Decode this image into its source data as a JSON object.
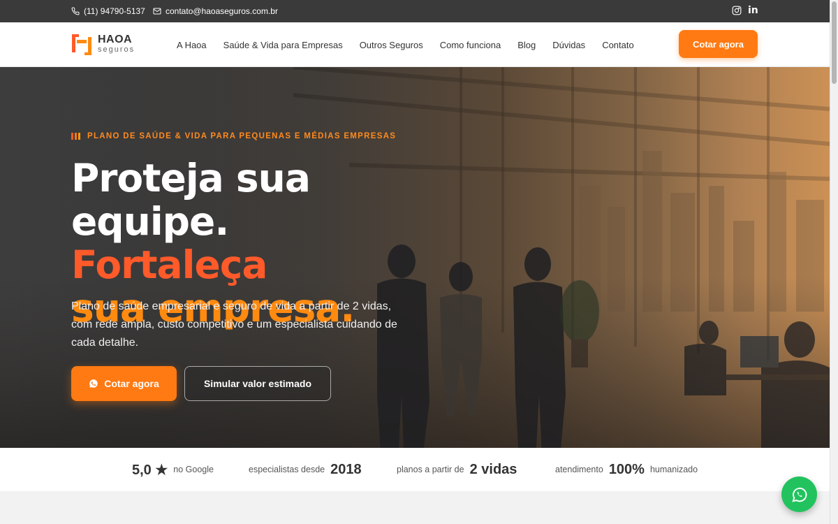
{
  "topbar": {
    "phone": "(11) 94790-5137",
    "email": "contato@haoaseguros.com.br",
    "social": [
      "instagram-icon",
      "linkedin-icon"
    ],
    "linkedin_label": "in"
  },
  "header": {
    "logo_name": "HAOA",
    "logo_sub": "seguros",
    "nav": [
      "A Haoa",
      "Saúde & Vida para Empresas",
      "Outros Seguros",
      "Como funciona",
      "Blog",
      "Dúvidas",
      "Contato"
    ],
    "cta": "Cotar agora"
  },
  "hero": {
    "eyebrow": "PLANO DE SAÚDE & VIDA PARA PEQUENAS E MÉDIAS EMPRESAS",
    "title_part1": "Proteja sua equipe. ",
    "title_part2": "Fortaleça",
    "title_part3": "sua empresa.",
    "description": "Plano de saúde empresarial e seguro de vida a partir de 2 vidas, com rede ampla, custo competitivo e um especialista cuidando de cada detalhe.",
    "primary_button": "Cotar agora",
    "secondary_button": "Simular valor estimado"
  },
  "stats": [
    {
      "value": "5,0 ★",
      "prefix": "",
      "suffix": "no Google"
    },
    {
      "value": "2018",
      "prefix": "especialistas desde",
      "suffix": ""
    },
    {
      "value": "2 vidas",
      "prefix": "planos a partir de",
      "suffix": ""
    },
    {
      "value": "100%",
      "prefix": "atendimento",
      "suffix": "humanizado"
    }
  ],
  "colors": {
    "accent": "#ff7a12",
    "accent_red": "#ff5a2a",
    "topbar": "#3a3a3a",
    "whatsapp": "#22c35e"
  }
}
